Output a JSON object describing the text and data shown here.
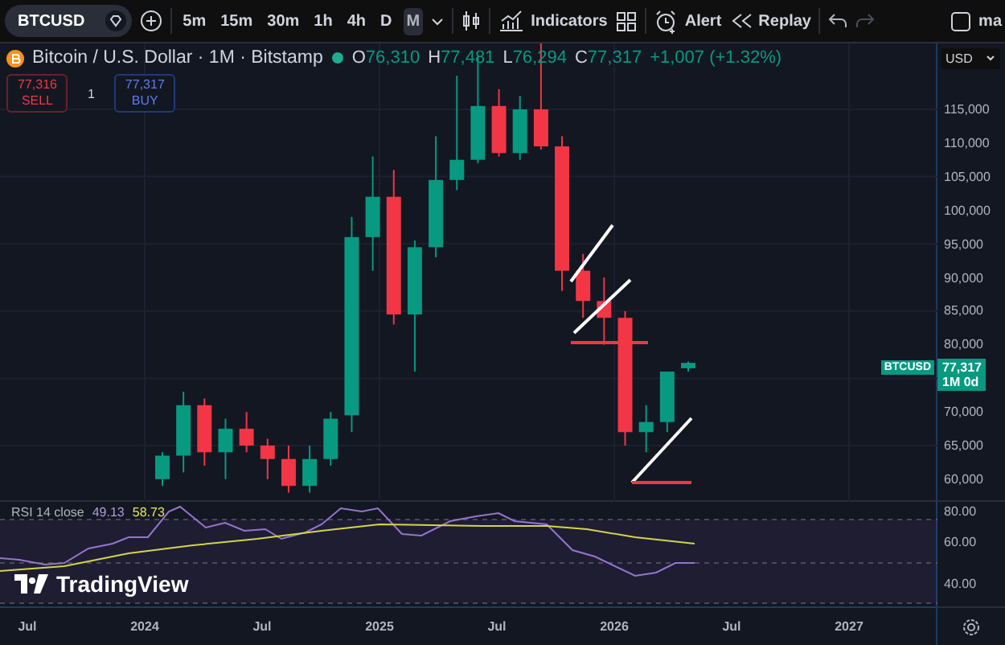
{
  "toolbar": {
    "symbol": "BTCUSD",
    "intervals": [
      {
        "label": "5m",
        "selected": false
      },
      {
        "label": "15m",
        "selected": false
      },
      {
        "label": "30m",
        "selected": false
      },
      {
        "label": "1h",
        "selected": false
      },
      {
        "label": "4h",
        "selected": false
      },
      {
        "label": "D",
        "selected": false
      },
      {
        "label": "M",
        "selected": true
      }
    ],
    "indicators_label": "Indicators",
    "alert_label": "Alert",
    "replay_label": "Replay",
    "cut_label": "ma"
  },
  "legend": {
    "title": "Bitcoin / U.S. Dollar · 1M · Bitstamp",
    "ohlc": [
      {
        "key": "O",
        "value": "76,310"
      },
      {
        "key": "H",
        "value": "77,481"
      },
      {
        "key": "L",
        "value": "76,294"
      },
      {
        "key": "C",
        "value": "77,317"
      }
    ],
    "change": "+1,007 (+1.32%)"
  },
  "trade": {
    "sell_price": "77,316",
    "sell_label": "SELL",
    "quantity": "1",
    "buy_price": "77,317",
    "buy_label": "BUY"
  },
  "price_axis": {
    "currency": "USD",
    "ticks": [
      "115,000",
      "110,000",
      "105,000",
      "100,000",
      "95,000",
      "90,000",
      "85,000",
      "80,000",
      "70,000",
      "65,000",
      "60,000"
    ],
    "last_price_symbol": "BTCUSD",
    "last_price": "77,317",
    "countdown": "1M 0d"
  },
  "rsi": {
    "title": "RSI 14 close",
    "value": "49.13",
    "ma_value": "58.73",
    "ticks": [
      "80.00",
      "60.00",
      "40.00"
    ]
  },
  "branding": {
    "logo_text": "TradingView"
  },
  "time_axis": {
    "labels": [
      "Jul",
      "2024",
      "Jul",
      "2025",
      "Jul",
      "2026",
      "Jul",
      "2027"
    ]
  }
}
